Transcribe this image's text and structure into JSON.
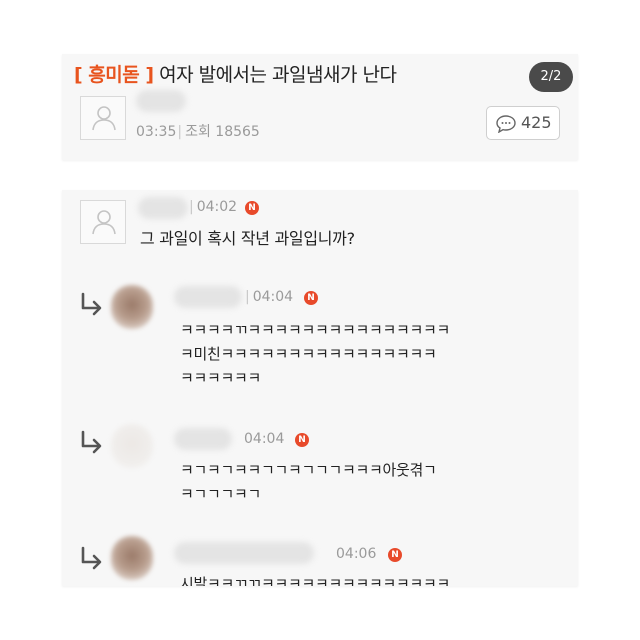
{
  "post": {
    "category": "[ 흥미돋 ]",
    "title": "여자 발에서는 과일냄새가 난다",
    "page_indicator": "2/2",
    "time": "03:35",
    "views_label": "조회",
    "views": "18565",
    "comment_count": "425"
  },
  "comments": [
    {
      "time": "04:02",
      "badge": "N",
      "text_lines": [
        "그 과일이 혹시 작년 과일입니까?"
      ]
    },
    {
      "time": "04:04",
      "badge": "N",
      "text_lines": [
        "ㅋㅋㅋㅋㄲㅋㅋㅋㅋㅋㅋㅋㅋㅋㅋㅋㅋㅋㅋㅋ",
        "ㅋ미친ㅋㅋㅋㅋㅋㅋㅋㅋㅋㅋㅋㅋㅋㅋㅋㅋ",
        "ㅋㅋㅋㅋㅋㅋ"
      ]
    },
    {
      "time": "04:04",
      "badge": "N",
      "text_lines": [
        "ㅋㄱㅋㄱㅋㅋㄱㄱㅋㄱㄱㄱㅋㅋㅋ아웃겪ㄱ",
        "ㅋㄱㄱㄱㅋㄱ"
      ]
    },
    {
      "time": "04:06",
      "badge": "N",
      "text_lines": [
        "시발ㅋㅋㄲㄲㅋㅋㅋㅋㅋㅋㅋㅋㅋㅋㅋㅋㅋㅋ"
      ]
    }
  ]
}
